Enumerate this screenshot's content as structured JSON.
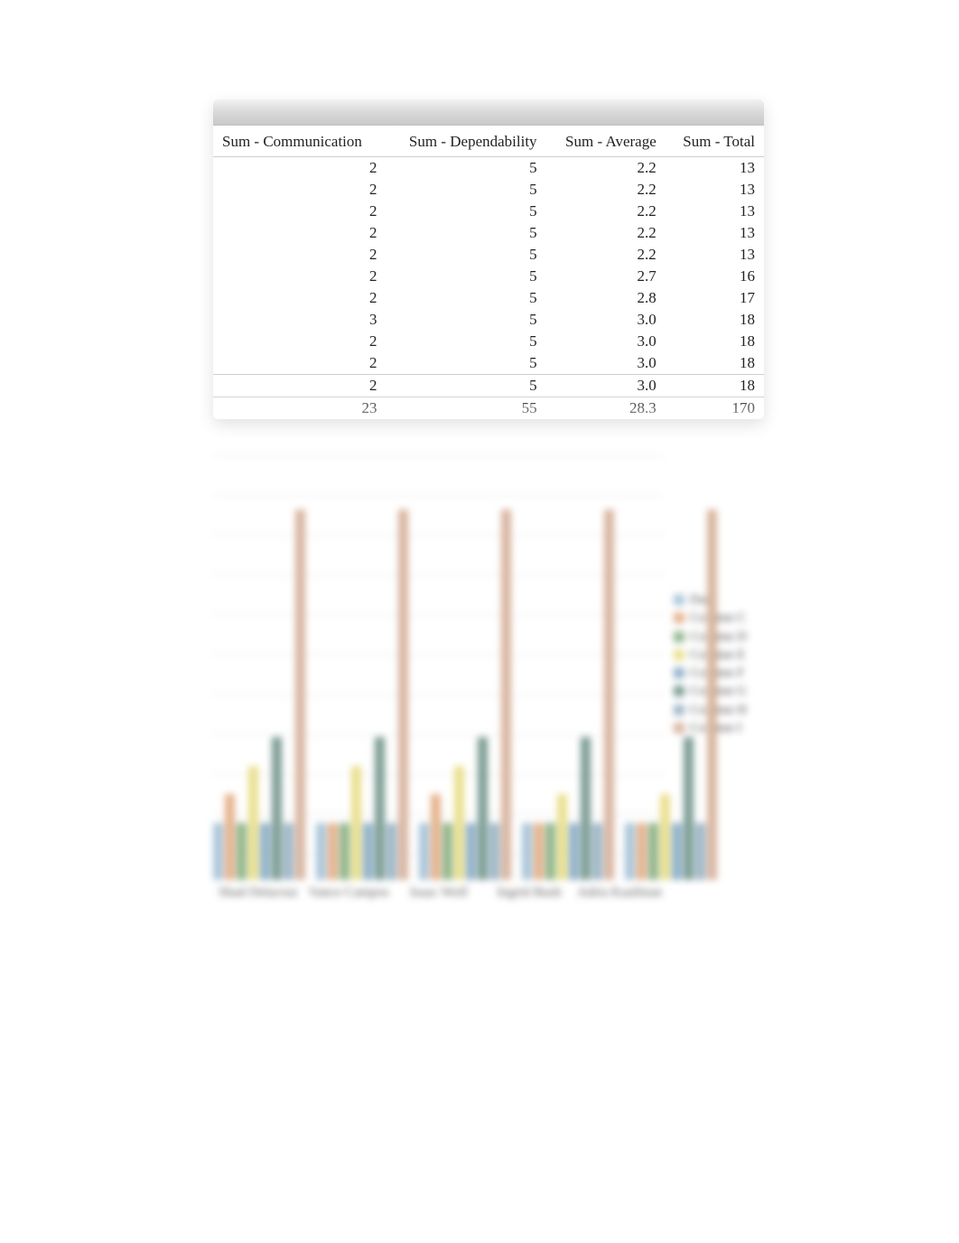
{
  "table": {
    "headers": [
      "Sum - Communication",
      "Sum - Dependability",
      "Sum - Average",
      "Sum - Total"
    ],
    "rows": [
      {
        "cells": [
          "2",
          "5",
          "2.2",
          "13"
        ]
      },
      {
        "cells": [
          "2",
          "5",
          "2.2",
          "13"
        ]
      },
      {
        "cells": [
          "2",
          "5",
          "2.2",
          "13"
        ]
      },
      {
        "cells": [
          "2",
          "5",
          "2.2",
          "13"
        ]
      },
      {
        "cells": [
          "2",
          "5",
          "2.2",
          "13"
        ]
      },
      {
        "cells": [
          "2",
          "5",
          "2.7",
          "16"
        ]
      },
      {
        "cells": [
          "2",
          "5",
          "2.8",
          "17"
        ]
      },
      {
        "cells": [
          "3",
          "5",
          "3.0",
          "18"
        ]
      },
      {
        "cells": [
          "2",
          "5",
          "3.0",
          "18"
        ]
      },
      {
        "cells": [
          "2",
          "5",
          "3.0",
          "18"
        ]
      },
      {
        "cells": [
          "2",
          "5",
          "3.0",
          "18"
        ]
      }
    ],
    "totals": {
      "cells": [
        "23",
        "55",
        "28.3",
        "170"
      ]
    }
  },
  "chart_data": {
    "type": "bar",
    "categories": [
      "Shad Delacruz",
      "Vance Campos",
      "Isaac Wolf",
      "Ingrid Bush",
      "Adria Kaufman"
    ],
    "series": [
      {
        "name": "Data",
        "color": "#a9c5d9",
        "values": [
          2,
          2,
          2,
          2,
          2
        ]
      },
      {
        "name": "Column C",
        "color": "#e5b28c",
        "values": [
          3,
          2,
          3,
          2,
          2
        ]
      },
      {
        "name": "Column D",
        "color": "#8fb58b",
        "values": [
          2,
          2,
          2,
          2,
          2
        ]
      },
      {
        "name": "Column E",
        "color": "#e9df8e",
        "values": [
          4,
          4,
          4,
          3,
          3
        ]
      },
      {
        "name": "Column F",
        "color": "#8fb0c9",
        "values": [
          2,
          2,
          2,
          2,
          2
        ]
      },
      {
        "name": "Column G",
        "color": "#7a9b92",
        "values": [
          5,
          5,
          5,
          5,
          5
        ]
      },
      {
        "name": "Column H",
        "color": "#9db6c7",
        "values": [
          2,
          2,
          2,
          2,
          2
        ]
      },
      {
        "name": "Column I",
        "color": "#d8b49f",
        "values": [
          13,
          13,
          13,
          13,
          13
        ]
      }
    ],
    "ylim": [
      0,
      14
    ],
    "xlabel": "",
    "ylabel": "",
    "title": ""
  },
  "legend_labels": [
    "Data",
    "Column C",
    "Column D",
    "Column E",
    "Column F",
    "Column G",
    "Column H",
    "Column I"
  ]
}
